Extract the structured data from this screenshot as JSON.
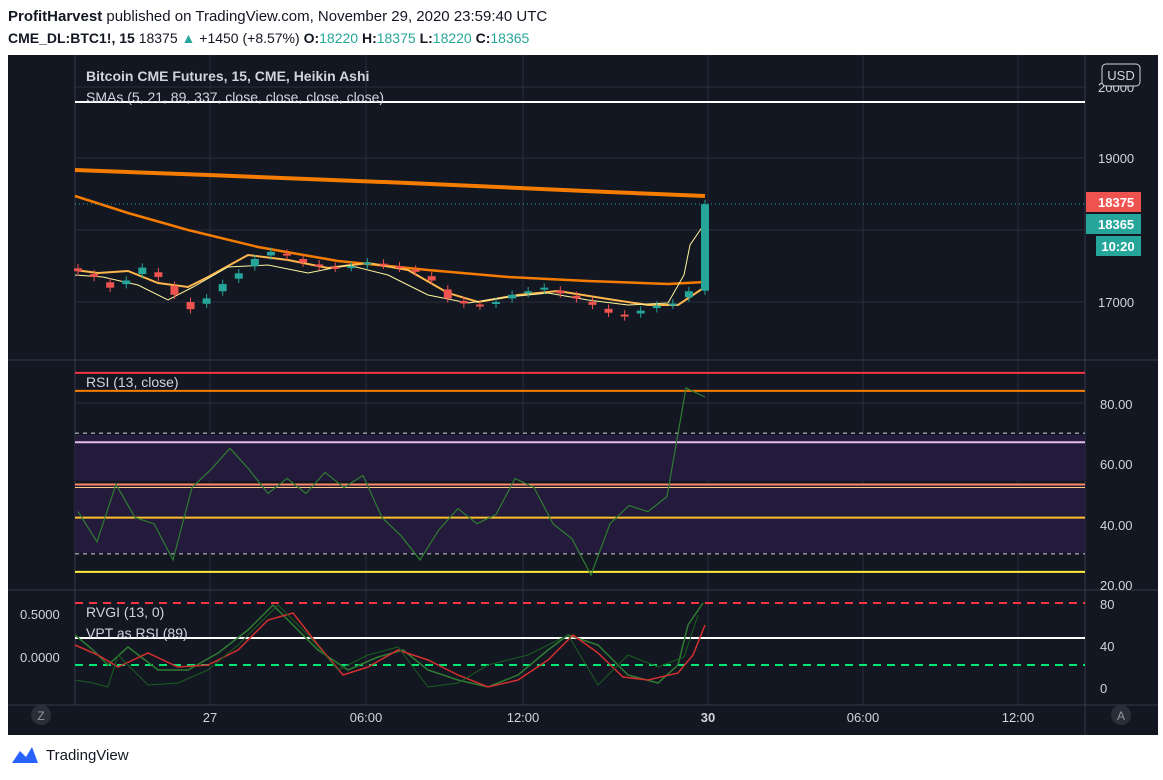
{
  "header": {
    "author": "ProfitHarvest",
    "published_text": "published on TradingView.com, November 29, 2020 23:59:40 UTC",
    "symbol": "CME_DL:BTC1!, 15",
    "last": "18375",
    "change": "+1450 (+8.57%)",
    "o_label": "O:",
    "o": "18220",
    "h_label": "H:",
    "h": "18375",
    "l_label": "L:",
    "l": "18220",
    "c_label": "C:",
    "c": "18365"
  },
  "main_pane": {
    "title": "Bitcoin CME Futures, 15, CME, Heikin Ashi",
    "sma_label": "SMAs (5, 21, 89, 337, close, close, close, close)",
    "currency": "USD",
    "price_labels": [
      "20000",
      "19000",
      "17000"
    ],
    "price_tag_red": "18375",
    "price_tag_green": "18365",
    "countdown": "10:20",
    "colors": {
      "up": "#26a69a",
      "down": "#ef5350",
      "sma_orange": "#f57c00",
      "sma_light": "#ffb74d",
      "bg": "#131722"
    }
  },
  "rsi_pane": {
    "label": "RSI (13, close)",
    "ticks": [
      "80.00",
      "60.00",
      "40.00",
      "20.00"
    ]
  },
  "rvgi_pane": {
    "label": "RVGI (13, 0)",
    "label2": "VPT as RSI (89)",
    "left_ticks": [
      "0.5000",
      "0.0000"
    ],
    "right_ticks": [
      "80",
      "40",
      "0"
    ]
  },
  "time_axis": {
    "labels": [
      "27",
      "06:00",
      "12:00",
      "30",
      "06:00",
      "12:00"
    ],
    "left_button": "Z",
    "right_button": "A"
  },
  "footer": {
    "brand": "TradingView"
  },
  "chart_data": {
    "type": "line",
    "price_close_approx": [
      17430,
      17350,
      17200,
      17300,
      17480,
      17350,
      17100,
      16900,
      17050,
      17250,
      17400,
      17600,
      17700,
      17650,
      17550,
      17500,
      17480,
      17500,
      17550,
      17520,
      17480,
      17420,
      17300,
      17050,
      16980,
      16950,
      17000,
      17100,
      17150,
      17200,
      17120,
      17050,
      16960,
      16850,
      16800,
      16880,
      16950,
      16980,
      17150,
      18365
    ],
    "rsi_approx": [
      44,
      34,
      53,
      42,
      40,
      28,
      52,
      58,
      65,
      58,
      50,
      55,
      50,
      57,
      52,
      56,
      42,
      36,
      28,
      38,
      45,
      40,
      43,
      55,
      52,
      40,
      35,
      23,
      40,
      46,
      44,
      49,
      85,
      82
    ],
    "rsi_levels": [
      90,
      84,
      70,
      67,
      53,
      52,
      42,
      30,
      24
    ],
    "ylim_price": [
      16400,
      20200
    ],
    "ylim_rsi": [
      18,
      93
    ]
  }
}
